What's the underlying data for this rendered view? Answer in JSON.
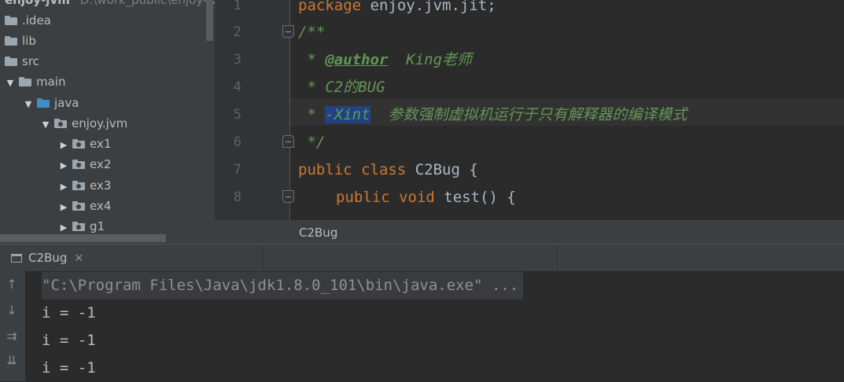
{
  "project_tree": {
    "root_label": "enjoy-jvm",
    "root_path": "D:\\work_public\\enjoy-jvm",
    "items": [
      {
        "label": ".idea",
        "icon": "folder-icon"
      },
      {
        "label": "lib",
        "icon": "folder-icon"
      },
      {
        "label": "src",
        "icon": "folder-icon"
      },
      {
        "label": "main",
        "icon": "folder-icon",
        "expanded": true
      },
      {
        "label": "java",
        "icon": "source-folder-icon",
        "expanded": true
      },
      {
        "label": "enjoy.jvm",
        "icon": "package-icon",
        "expanded": true
      },
      {
        "label": "ex1",
        "icon": "package-icon"
      },
      {
        "label": "ex2",
        "icon": "package-icon"
      },
      {
        "label": "ex3",
        "icon": "package-icon"
      },
      {
        "label": "ex4",
        "icon": "package-icon"
      },
      {
        "label": "g1",
        "icon": "package-icon"
      }
    ]
  },
  "editor": {
    "line_numbers": [
      "1",
      "2",
      "3",
      "4",
      "5",
      "6",
      "7",
      "8"
    ],
    "lines": {
      "l1_kw": "package",
      "l1_rest": " enjoy.jvm.jit;",
      "l2": "/**",
      "l3_star": " * ",
      "l3_tag": "@author",
      "l3_text": "  King老师",
      "l4": " * C2的BUG",
      "l5_star": " * ",
      "l5_sel": "-Xint",
      "l5_text": "  参数强制虚拟机运行于只有解释器的编译模式",
      "l6": " */",
      "l7_kw1": "public",
      "l7_kw2": "class",
      "l7_rest": " C2Bug {",
      "l8_kw1": "public",
      "l8_kw2": "void",
      "l8_rest": " test() {"
    },
    "breadcrumb_tab": "C2Bug"
  },
  "run_window": {
    "tab_label": "C2Bug",
    "command": "\"C:\\Program Files\\Java\\jdk1.8.0_101\\bin\\java.exe\" ...",
    "output": [
      "i = -1",
      "i = -1",
      "i = -1"
    ]
  },
  "colors": {
    "keyword": "#cc7832",
    "doc_comment": "#629755",
    "selection": "#214283",
    "background": "#2b2b2b"
  }
}
